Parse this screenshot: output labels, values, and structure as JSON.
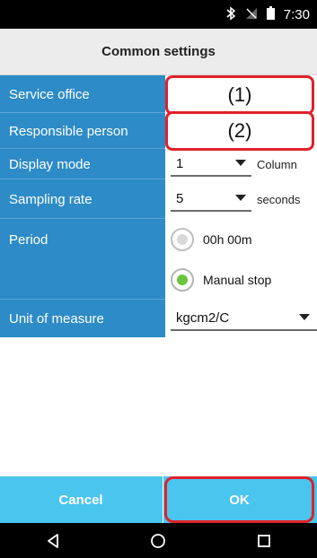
{
  "status_bar": {
    "time": "7:30",
    "icons": [
      "bluetooth-icon",
      "no-signal-icon",
      "battery-icon"
    ]
  },
  "title": "Common settings",
  "form": {
    "service_office": {
      "label": "Service office",
      "marker": "(1)"
    },
    "responsible_person": {
      "label": "Responsible person",
      "marker": "(2)"
    },
    "display_mode": {
      "label": "Display mode",
      "value": "1",
      "unit": "Column"
    },
    "sampling_rate": {
      "label": "Sampling rate",
      "value": "5",
      "unit": "seconds"
    },
    "period": {
      "label": "Period",
      "option_time": "00h 00m",
      "option_manual": "Manual stop",
      "selected": "Manual stop"
    },
    "unit_of_measure": {
      "label": "Unit of measure",
      "value": "kgcm2/C"
    }
  },
  "buttons": {
    "cancel": "Cancel",
    "ok": "OK"
  },
  "colors": {
    "label_bg": "#2d8bc7",
    "button_bar": "#49c5ee",
    "highlight": "#e0212a",
    "radio_selected": "#6ac43c"
  },
  "nav": [
    "back-icon",
    "home-icon",
    "recents-icon"
  ]
}
